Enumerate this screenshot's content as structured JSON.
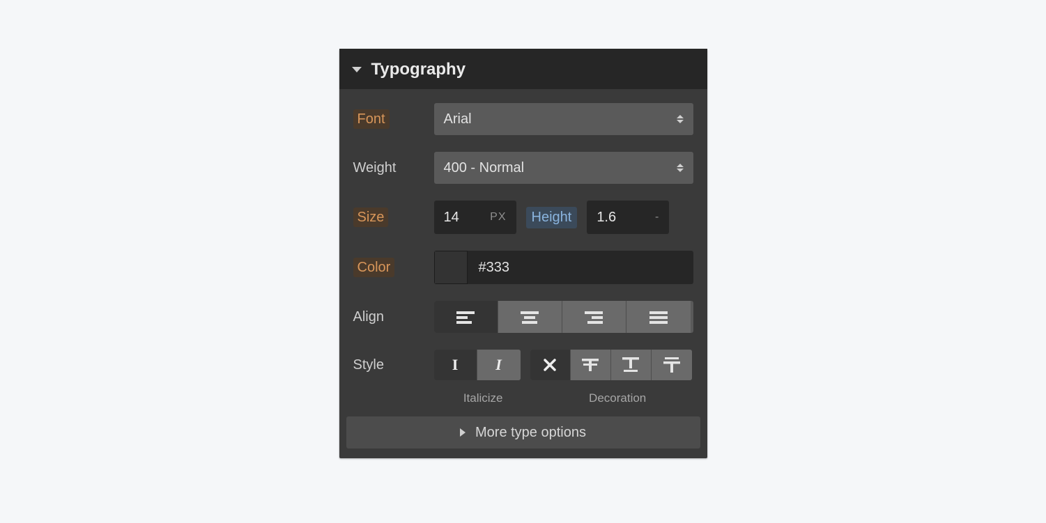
{
  "panel": {
    "title": "Typography",
    "font": {
      "label": "Font",
      "value": "Arial"
    },
    "weight": {
      "label": "Weight",
      "value": "400 - Normal"
    },
    "size": {
      "label": "Size",
      "value": "14",
      "unit": "PX"
    },
    "height": {
      "label": "Height",
      "value": "1.6",
      "unit": "-"
    },
    "color": {
      "label": "Color",
      "value": "#333",
      "swatch": "#333333"
    },
    "align": {
      "label": "Align"
    },
    "style": {
      "label": "Style",
      "italicize_label": "Italicize",
      "decoration_label": "Decoration"
    },
    "more": "More type options"
  }
}
